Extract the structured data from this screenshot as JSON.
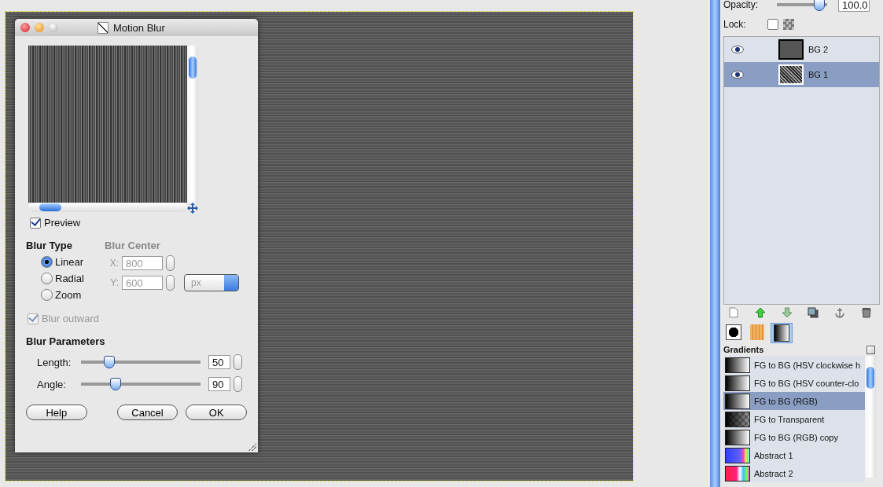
{
  "dialog": {
    "title": "Motion Blur",
    "preview": {
      "label": "Preview",
      "checked": true
    },
    "blur_type": {
      "heading": "Blur Type",
      "options": [
        {
          "label": "Linear",
          "selected": true
        },
        {
          "label": "Radial",
          "selected": false
        },
        {
          "label": "Zoom",
          "selected": false
        }
      ]
    },
    "blur_center": {
      "heading": "Blur Center",
      "disabled": true,
      "x_label": "X:",
      "x_value": "800",
      "y_label": "Y:",
      "y_value": "600",
      "unit": "px"
    },
    "blur_outward": {
      "label": "Blur outward",
      "checked": true,
      "disabled": true
    },
    "parameters": {
      "heading": "Blur Parameters",
      "sliders": [
        {
          "label": "Length:",
          "level": 0.24,
          "value": "50"
        },
        {
          "label": "Angle:",
          "level": 0.29,
          "value": "90"
        }
      ]
    },
    "buttons": [
      "Help",
      "Cancel",
      "OK"
    ]
  },
  "layers": {
    "opacity": {
      "label": "Opacity:",
      "level": 0.85,
      "value": "100.0"
    },
    "lock": {
      "label": "Lock:",
      "checked": false
    },
    "items": [
      {
        "name": "BG 2",
        "visible": true,
        "selected": false,
        "kind": "smooth"
      },
      {
        "name": "BG 1",
        "visible": true,
        "selected": true,
        "kind": "noise"
      }
    ]
  },
  "dock_tabs": [
    {
      "kind": "brush",
      "selected": false
    },
    {
      "kind": "pattern",
      "selected": false
    },
    {
      "kind": "gradient",
      "selected": true
    }
  ],
  "gradients": {
    "title": "Gradients",
    "items": [
      {
        "name": "FG to BG (HSV clockwise h",
        "selected": false,
        "kind": "fade"
      },
      {
        "name": "FG to BG (HSV counter-clo",
        "selected": false,
        "kind": "fade"
      },
      {
        "name": "FG to BG (RGB)",
        "selected": true,
        "kind": "fade"
      },
      {
        "name": "FG to Transparent",
        "selected": false,
        "kind": "transparent"
      },
      {
        "name": "FG to BG (RGB) copy",
        "selected": false,
        "kind": "fade"
      },
      {
        "name": "Abstract 1",
        "selected": false,
        "kind": "abstract1"
      },
      {
        "name": "Abstract 2",
        "selected": false,
        "kind": "abstract2"
      }
    ]
  }
}
